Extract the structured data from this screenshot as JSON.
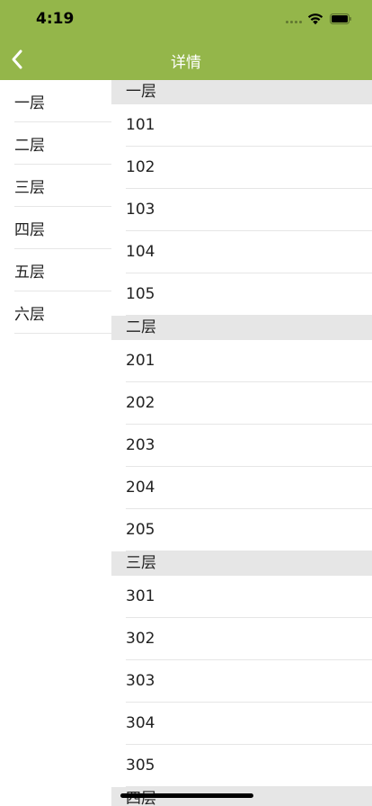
{
  "status_bar": {
    "time": "4:19"
  },
  "nav": {
    "title": "详情",
    "back_icon": "chevron-left-icon"
  },
  "colors": {
    "nav_background": "#94b64a",
    "section_background": "#e6e6e6"
  },
  "floors": [
    {
      "label": "一层"
    },
    {
      "label": "二层"
    },
    {
      "label": "三层"
    },
    {
      "label": "四层"
    },
    {
      "label": "五层"
    },
    {
      "label": "六层"
    }
  ],
  "sections": [
    {
      "title": "一层",
      "rooms": [
        "101",
        "102",
        "103",
        "104",
        "105"
      ]
    },
    {
      "title": "二层",
      "rooms": [
        "201",
        "202",
        "203",
        "204",
        "205"
      ]
    },
    {
      "title": "三层",
      "rooms": [
        "301",
        "302",
        "303",
        "304",
        "305"
      ]
    },
    {
      "title": "四层",
      "rooms": []
    }
  ]
}
